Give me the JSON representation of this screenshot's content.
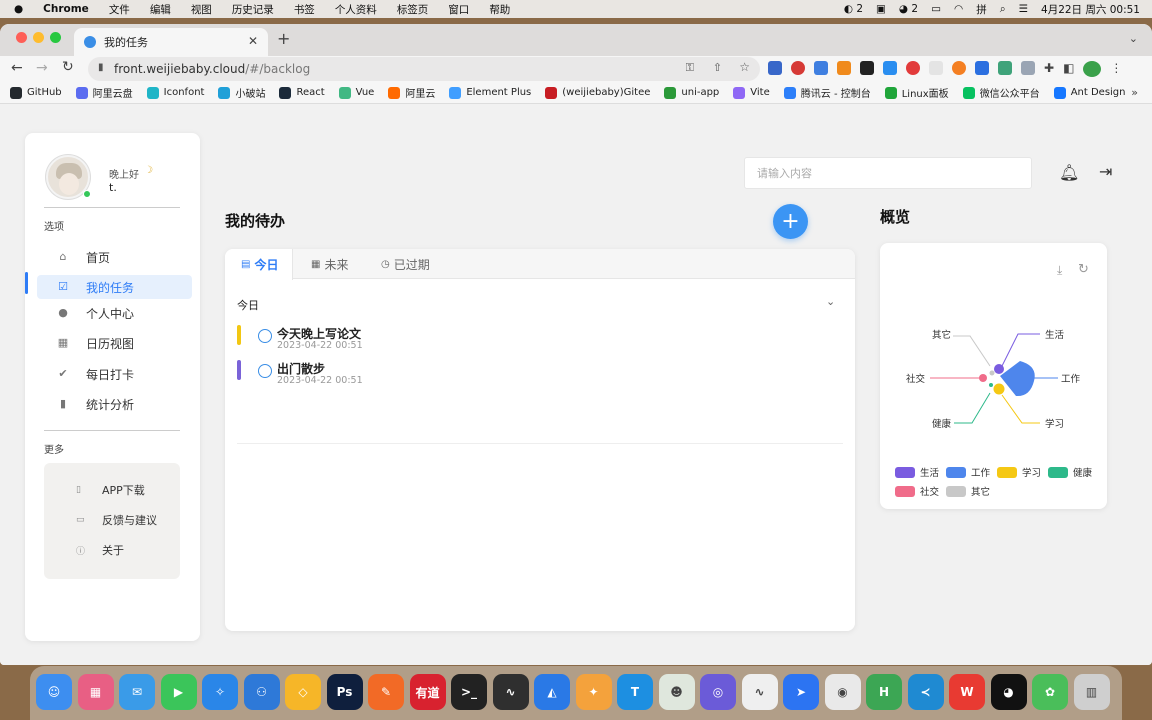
{
  "menubar": {
    "app": "Chrome",
    "items": [
      "文件",
      "编辑",
      "视图",
      "历史记录",
      "书签",
      "个人资料",
      "标签页",
      "窗口",
      "帮助"
    ],
    "wechat_count": "2",
    "notif_count": "2",
    "datetime": "4月22日 周六 00:51"
  },
  "browser": {
    "tab_title": "我的任务",
    "url_host": "front.weijiebaby.cloud",
    "url_path": "/#/backlog",
    "bookmarks": [
      {
        "label": "GitHub",
        "color": "#24292e"
      },
      {
        "label": "阿里云盘",
        "color": "#5b6cf0"
      },
      {
        "label": "Iconfont",
        "color": "#1fb5c7"
      },
      {
        "label": "小破站",
        "color": "#20a0d8"
      },
      {
        "label": "React",
        "color": "#1b2a3a"
      },
      {
        "label": "Vue",
        "color": "#41b883"
      },
      {
        "label": "阿里云",
        "color": "#ff6a00"
      },
      {
        "label": "Element Plus",
        "color": "#409eff"
      },
      {
        "label": "(weijiebaby)Gitee",
        "color": "#c71d23"
      },
      {
        "label": "uni-app",
        "color": "#2b9939"
      },
      {
        "label": "Vite",
        "color": "#8f68f5"
      },
      {
        "label": "腾讯云 - 控制台",
        "color": "#2d7ff9"
      },
      {
        "label": "Linux面板",
        "color": "#20a53a"
      },
      {
        "label": "微信公众平台",
        "color": "#07c160"
      },
      {
        "label": "Ant Design",
        "color": "#1677ff"
      }
    ]
  },
  "sidebar": {
    "greeting": "晚上好",
    "username": "t.",
    "section_options": "选项",
    "nav": [
      {
        "label": "首页",
        "icon": "home-icon",
        "glyph": "⌂"
      },
      {
        "label": "我的任务",
        "icon": "task-icon",
        "glyph": "☑"
      },
      {
        "label": "个人中心",
        "icon": "user-icon",
        "glyph": "●"
      },
      {
        "label": "日历视图",
        "icon": "calendar-icon",
        "glyph": "▦"
      },
      {
        "label": "每日打卡",
        "icon": "check-circle-icon",
        "glyph": "✔"
      },
      {
        "label": "统计分析",
        "icon": "bar-chart-icon",
        "glyph": "▮"
      }
    ],
    "section_more": "更多",
    "more": [
      {
        "label": "APP下载",
        "icon": "download-app-icon",
        "glyph": "▯"
      },
      {
        "label": "反馈与建议",
        "icon": "feedback-icon",
        "glyph": "▭"
      },
      {
        "label": "关于",
        "icon": "info-icon",
        "glyph": "ⓘ"
      }
    ]
  },
  "header": {
    "search_placeholder": "请输入内容"
  },
  "main": {
    "title": "我的待办",
    "tabs": [
      "今日",
      "未来",
      "已过期"
    ],
    "group_label": "今日",
    "tasks": [
      {
        "title": "今天晚上写论文",
        "date": "2023-04-22 00:51",
        "color": "#f2c713"
      },
      {
        "title": "出门散步",
        "date": "2023-04-22 00:51",
        "color": "#7a63d8"
      }
    ]
  },
  "overview": {
    "title": "概览",
    "accent": "#4e86ec",
    "categories": [
      {
        "label": "生活",
        "color": "#7a5ce0"
      },
      {
        "label": "工作",
        "color": "#4e86ec"
      },
      {
        "label": "学习",
        "color": "#f5c814"
      },
      {
        "label": "健康",
        "color": "#2db98a"
      },
      {
        "label": "社交",
        "color": "#f06c8a"
      },
      {
        "label": "其它",
        "color": "#c8c8c8"
      }
    ]
  },
  "dock": {
    "apps": [
      {
        "name": "finder",
        "color": "#3d8ef0",
        "glyph": "☺"
      },
      {
        "name": "launchpad",
        "color": "#e85f84",
        "glyph": "▦"
      },
      {
        "name": "mail",
        "color": "#3a9be8",
        "glyph": "✉"
      },
      {
        "name": "facetime",
        "color": "#3bc55a",
        "glyph": "▶"
      },
      {
        "name": "safari",
        "color": "#2a86e8",
        "glyph": "✧"
      },
      {
        "name": "sourcetree",
        "color": "#2e79d8",
        "glyph": "⚇"
      },
      {
        "name": "sketch",
        "color": "#f6b628",
        "glyph": "◇"
      },
      {
        "name": "photoshop",
        "color": "#0f1f3d",
        "glyph": "Ps"
      },
      {
        "name": "pen-app",
        "color": "#f26a26",
        "glyph": "✎"
      },
      {
        "name": "youdao",
        "color": "#d8222f",
        "glyph": "有道"
      },
      {
        "name": "terminal",
        "color": "#222222",
        "glyph": ">_"
      },
      {
        "name": "activity-monitor",
        "color": "#2f2f2f",
        "glyph": "∿"
      },
      {
        "name": "app-blue",
        "color": "#2a79e6",
        "glyph": "◭"
      },
      {
        "name": "app-orange",
        "color": "#f4a23c",
        "glyph": "✦"
      },
      {
        "name": "app-teal",
        "color": "#1d8fe1",
        "glyph": "T"
      },
      {
        "name": "wechat",
        "color": "#dfe7dd",
        "glyph": "☻"
      },
      {
        "name": "app-rainbow",
        "color": "#6b5bd8",
        "glyph": "◎"
      },
      {
        "name": "app-chart",
        "color": "#efefef",
        "glyph": "∿"
      },
      {
        "name": "lark",
        "color": "#2c74f2",
        "glyph": "➤"
      },
      {
        "name": "chrome",
        "color": "#e9e9e9",
        "glyph": "◉"
      },
      {
        "name": "hbuilder",
        "color": "#3ca654",
        "glyph": "H"
      },
      {
        "name": "vscode",
        "color": "#1f8ad2",
        "glyph": "≺"
      },
      {
        "name": "wps",
        "color": "#e83a32",
        "glyph": "W"
      },
      {
        "name": "qq",
        "color": "#111111",
        "glyph": "◕"
      },
      {
        "name": "app-green",
        "color": "#4abe5a",
        "glyph": "✿"
      },
      {
        "name": "trash",
        "color": "#cfcfcf",
        "glyph": "▥"
      }
    ]
  }
}
